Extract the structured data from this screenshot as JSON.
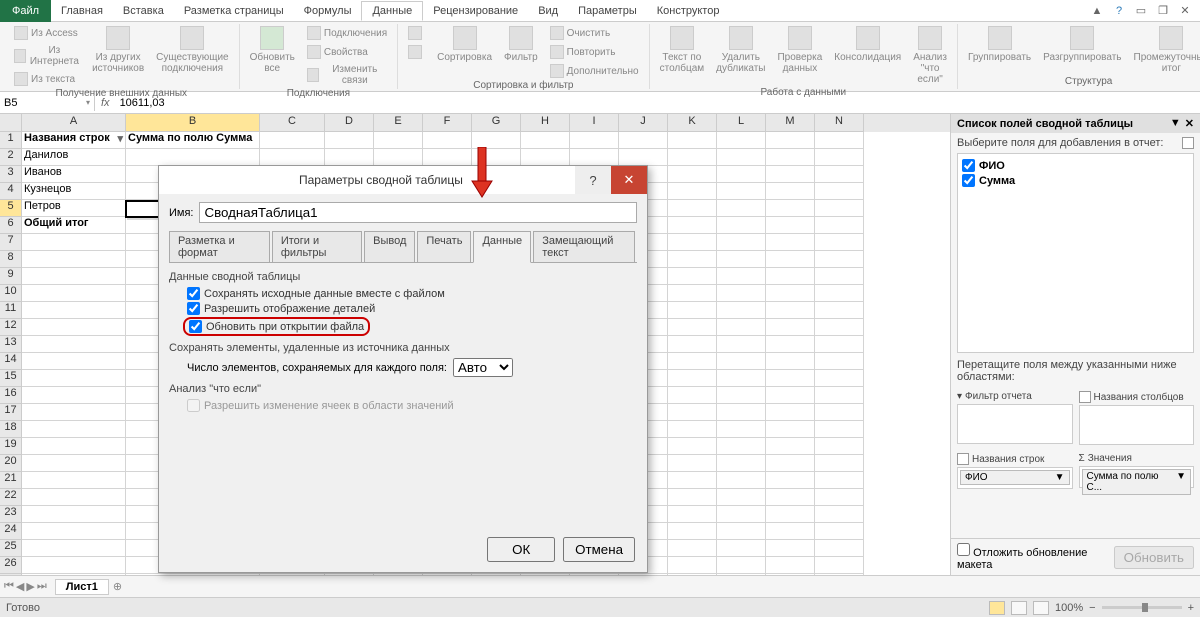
{
  "tabs": {
    "file": "Файл",
    "items": [
      "Главная",
      "Вставка",
      "Разметка страницы",
      "Формулы",
      "Данные",
      "Рецензирование",
      "Вид",
      "Параметры",
      "Конструктор"
    ],
    "active_index": 4
  },
  "ribbon_groups": {
    "external": {
      "label": "Получение внешних данных",
      "items": [
        "Из Access",
        "Из Интернета",
        "Из текста",
        "Из других источников",
        "Существующие подключения"
      ]
    },
    "connections": {
      "label": "Подключения",
      "main": "Обновить все",
      "sub": [
        "Подключения",
        "Свойства",
        "Изменить связи"
      ]
    },
    "sort": {
      "label": "Сортировка и фильтр",
      "az": "А↓",
      "za": "Я↑",
      "sort": "Сортировка",
      "filter": "Фильтр",
      "clear": "Очистить",
      "reapply": "Повторить",
      "advanced": "Дополнительно"
    },
    "datatools": {
      "label": "Работа с данными",
      "t1": "Текст по столбцам",
      "t2": "Удалить дубликаты",
      "t3": "Проверка данных",
      "t4": "Консолидация",
      "t5": "Анализ \"что если\""
    },
    "structure": {
      "label": "Структура",
      "g": "Группировать",
      "u": "Разгруппировать",
      "s": "Промежуточный итог"
    }
  },
  "formula_bar": {
    "cell_ref": "B5",
    "value": "10611,03"
  },
  "columns": [
    "A",
    "B",
    "C",
    "D",
    "E",
    "F",
    "G",
    "H",
    "I",
    "J",
    "K",
    "L",
    "M",
    "N"
  ],
  "row_count": 27,
  "selected_row": 5,
  "selected_col": "B",
  "table": {
    "header_a": "Названия строк",
    "header_b": "Сумма по полю Сумма",
    "rows": [
      {
        "a": "Данилов",
        "b": ""
      },
      {
        "a": "Иванов",
        "b": ""
      },
      {
        "a": "Кузнецов",
        "b": ""
      },
      {
        "a": "Петров",
        "b": ""
      }
    ],
    "total": "Общий итог"
  },
  "dialog": {
    "title": "Параметры сводной таблицы",
    "name_label": "Имя:",
    "name_value": "СводнаяТаблица1",
    "tabs": [
      "Разметка и формат",
      "Итоги и фильтры",
      "Вывод",
      "Печать",
      "Данные",
      "Замещающий текст"
    ],
    "active_tab": 4,
    "section1": "Данные сводной таблицы",
    "chk1": "Сохранять исходные данные вместе с файлом",
    "chk2": "Разрешить отображение деталей",
    "chk3": "Обновить при открытии файла",
    "section2": "Сохранять элементы, удаленные из источника данных",
    "keep_label": "Число элементов, сохраняемых для каждого поля:",
    "keep_value": "Авто",
    "section3": "Анализ \"что если\"",
    "chk4": "Разрешить изменение ячеек в области значений",
    "ok": "ОК",
    "cancel": "Отмена",
    "help": "?",
    "close": "✕"
  },
  "field_panel": {
    "title": "Список полей сводной таблицы",
    "choose": "Выберите поля для добавления в отчет:",
    "fields": [
      "ФИО",
      "Сумма"
    ],
    "drag": "Перетащите поля между указанными ниже областями:",
    "zone_filter": "Фильтр отчета",
    "zone_cols": "Названия столбцов",
    "zone_rows": "Названия строк",
    "zone_vals": "Значения",
    "row_pill": "ФИО",
    "val_pill": "Сумма по полю С...",
    "delay": "Отложить обновление макета",
    "update": "Обновить"
  },
  "sheet": {
    "tab": "Лист1",
    "nav": [
      "⏮",
      "◀",
      "▶",
      "⏭"
    ]
  },
  "status": {
    "ready": "Готово",
    "zoom": "100%",
    "minus": "−",
    "plus": "+"
  }
}
